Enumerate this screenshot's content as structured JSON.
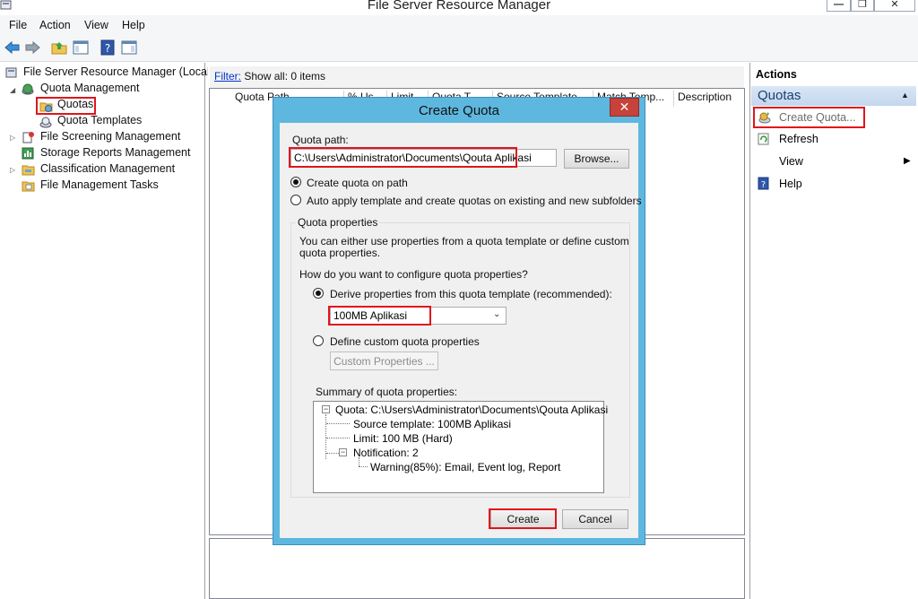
{
  "window": {
    "title": "File Server Resource Manager",
    "controls": {
      "minimize": "—",
      "maximize": "❐",
      "close": "✕"
    }
  },
  "menu": [
    "File",
    "Action",
    "View",
    "Help"
  ],
  "toolbar": [
    "back-arrow-icon",
    "forward-arrow-icon",
    "up-folder-icon",
    "show-hide-tree-icon",
    "help-icon",
    "action-pane-icon"
  ],
  "tree": {
    "root": "File Server Resource Manager (Local)",
    "quota_management": "Quota Management",
    "quotas": "Quotas",
    "quota_templates": "Quota Templates",
    "file_screening": "File Screening Management",
    "storage_reports": "Storage Reports Management",
    "classification": "Classification Management",
    "file_management_tasks": "File Management Tasks"
  },
  "center": {
    "filter_label": "Filter:",
    "filter_text": "Show all: 0 items",
    "columns": [
      "Quota Path",
      "% Us...",
      "Limit",
      "Quota T...",
      "Source Template",
      "Match Temp...",
      "Description"
    ]
  },
  "actions": {
    "header": "Actions",
    "group": "Quotas",
    "items": {
      "create_quota": "Create Quota...",
      "refresh": "Refresh",
      "view": "View",
      "help": "Help"
    }
  },
  "dialog": {
    "title": "Create Quota",
    "close": "✕",
    "quota_path_label": "Quota path:",
    "quota_path_value": "C:\\Users\\Administrator\\Documents\\Qouta Aplikasi",
    "browse_button": "Browse...",
    "radio_create_on_path": "Create quota on path",
    "radio_auto_apply": "Auto apply template and create quotas on existing and new subfolders",
    "quota_properties_label": "Quota properties",
    "quota_properties_desc_1": "You can either use properties from a quota template or define custom",
    "quota_properties_desc_2": "quota properties.",
    "configure_question": "How do you want to configure quota properties?",
    "radio_derive": "Derive properties from this quota template (recommended):",
    "template_selected": "100MB Aplikasi",
    "radio_custom": "Define custom quota properties",
    "custom_properties_button": "Custom Properties ...",
    "summary_label": "Summary of quota properties:",
    "summary": {
      "quota": "Quota: C:\\Users\\Administrator\\Documents\\Qouta Aplikasi",
      "source_template": "Source template: 100MB Aplikasi",
      "limit": "Limit: 100 MB (Hard)",
      "notification": "Notification: 2",
      "warning": "Warning(85%): Email, Event log, Report"
    },
    "create_button": "Create",
    "cancel_button": "Cancel"
  },
  "colors": {
    "highlight": "#e0151c",
    "dialog_frame": "#5eb7df",
    "close_button": "#c7423b",
    "link": "#0033cc"
  }
}
